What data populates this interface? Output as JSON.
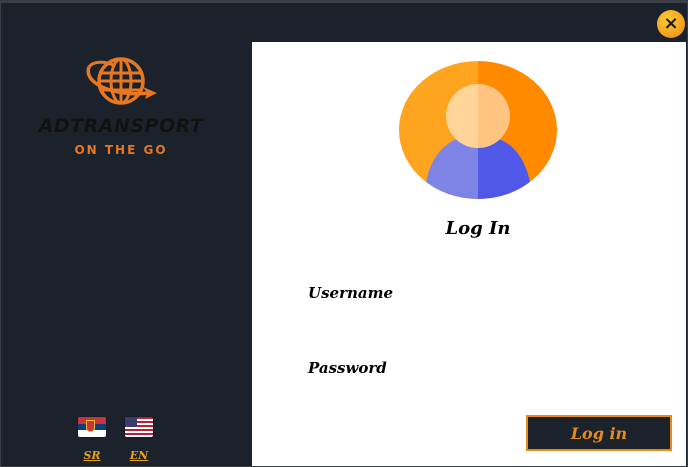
{
  "window": {
    "close_label": "×"
  },
  "brand": {
    "name": "ADTRANSPORT",
    "tagline": "ON THE GO",
    "logo_icon": "globe-plane-icon",
    "accent": "#e87722"
  },
  "languages": [
    {
      "code": "SR",
      "flag": "serbia-flag-icon"
    },
    {
      "code": "EN",
      "flag": "usa-flag-icon"
    }
  ],
  "login": {
    "title": "Log In",
    "username_label": "Username",
    "username_value": "",
    "password_label": "Password",
    "password_value": "",
    "submit_label": "Log in"
  },
  "colors": {
    "sidebar": "#1c222c",
    "accent": "#e88a1a",
    "panel": "#ffffff"
  }
}
